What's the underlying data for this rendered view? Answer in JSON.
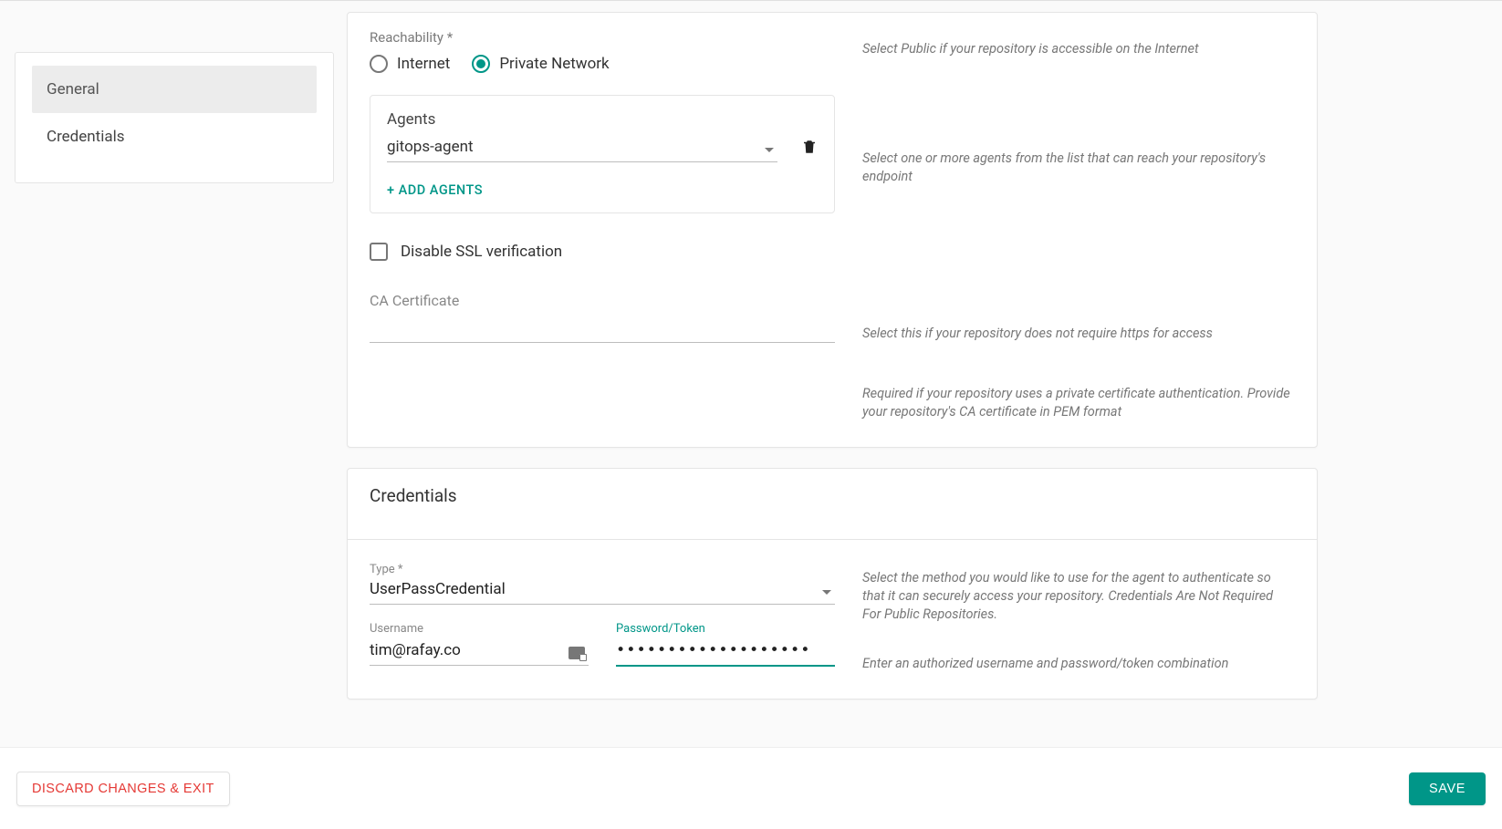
{
  "sidebar": {
    "items": [
      {
        "label": "General"
      },
      {
        "label": "Credentials"
      }
    ]
  },
  "reachability": {
    "label": "Reachability *",
    "options": {
      "internet": "Internet",
      "private": "Private Network"
    },
    "help": "Select Public if your repository is accessible on the Internet"
  },
  "agents": {
    "label": "Agents",
    "selected": "gitops-agent",
    "add_label": "+ ADD  AGENTS",
    "help": "Select one or more agents from the list that can reach your repository's endpoint"
  },
  "ssl": {
    "checkbox_label": "Disable SSL verification",
    "help": "Select this if your repository does not require https for access"
  },
  "ca": {
    "label": "CA Certificate",
    "value": "",
    "help": "Required if your repository uses a private certificate authentication. Provide your repository's CA certificate in PEM format"
  },
  "credentials": {
    "header": "Credentials",
    "type_label": "Type *",
    "type_value": "UserPassCredential",
    "type_help": "Select the method you would like to use for the agent to authenticate so that it can securely access your repository. Credentials Are Not Required For Public Repositories.",
    "username_label": "Username",
    "username_value": "tim@rafay.co",
    "password_label": "Password/Token",
    "password_value": "••••••••••••••••••••••••••••••••••••••••",
    "user_help": "Enter an authorized username and password/token combination"
  },
  "footer": {
    "discard": "DISCARD CHANGES & EXIT",
    "save": "SAVE"
  }
}
